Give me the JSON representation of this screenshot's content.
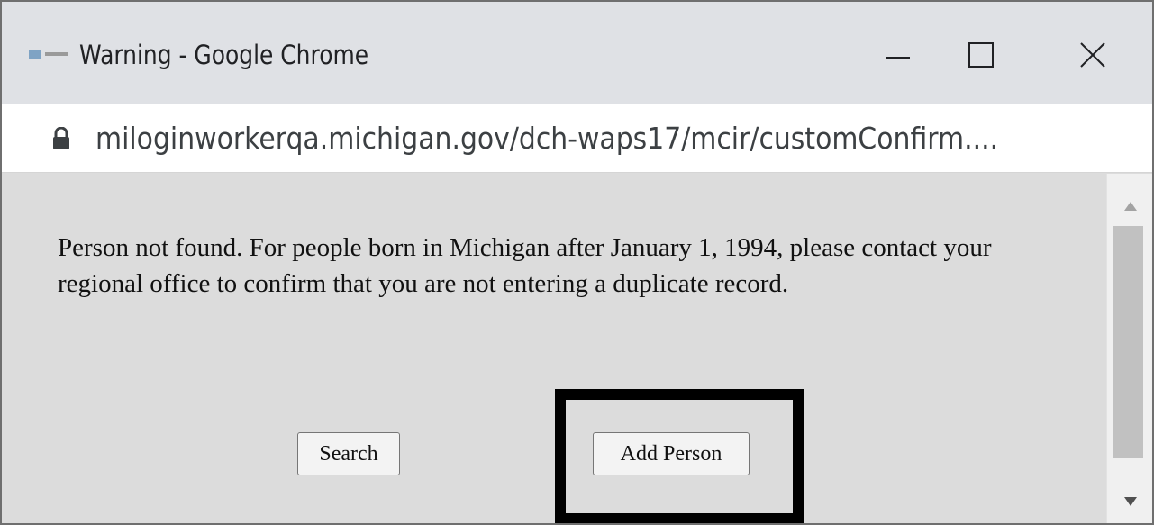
{
  "window": {
    "title": "Warning - Google Chrome",
    "icons": {
      "favicon": "site-favicon-icon",
      "minimize": "minimize-icon",
      "maximize": "maximize-icon",
      "close": "close-icon"
    }
  },
  "address_bar": {
    "icon": "lock-icon",
    "url": "miloginworkerqa.michigan.gov/dch-waps17/mcir/customConfirm...."
  },
  "dialog": {
    "message": "Person not found. For people born in Michigan after January 1, 1994, please contact your regional office to confirm that you are not entering a duplicate record.",
    "buttons": {
      "search_label": "Search",
      "add_person_label": "Add Person"
    },
    "highlight_color": "#000000"
  },
  "scrollbar": {
    "up_icon": "scroll-up-arrow-icon",
    "down_icon": "scroll-down-arrow-icon"
  }
}
